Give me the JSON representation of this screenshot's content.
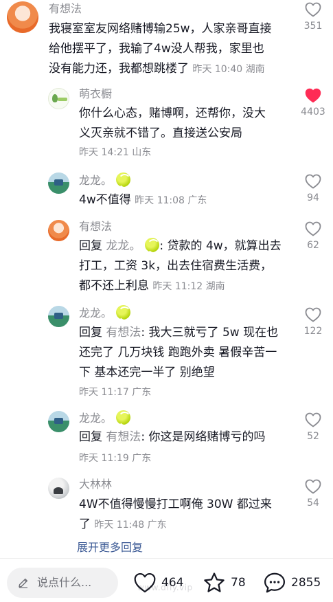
{
  "comments": [
    {
      "author": "有想法",
      "lines": [
        "我寝室室友网络赌博输25w，人家亲哥直接",
        "给他摆平了，我输了4w没人帮我，家里也",
        "没有能力还，我都想跳楼了"
      ],
      "meta": "昨天 10:40 湖南",
      "likes": "351",
      "liked": false,
      "avatar": "orange-anime-avatar"
    },
    {
      "author": "萌衣橱",
      "lines": [
        "你什么心态，赌博啊，还帮你，没大",
        "义灭亲就不错了。直接送公安局"
      ],
      "meta": "昨天 14:21 山东",
      "likes": "4403",
      "liked": true,
      "avatar": "green-logo-avatar"
    }
  ],
  "replies": [
    {
      "author": "龙龙。",
      "reply_label": "",
      "reply_to": "",
      "lines": [
        "4w不值得"
      ],
      "meta": "昨天 11:08 广东",
      "likes": "94",
      "avatar": "tennis-court-avatar",
      "badge": "tennis-ball-icon"
    },
    {
      "author": "有想法",
      "reply_label": "回复",
      "reply_to": "龙龙。",
      "lines": [
        "贷款的 4w，就算出去",
        "打工，工资 3k，出去住宿费生活费，",
        "都不还上利息"
      ],
      "meta": "昨天 11:12 湖南",
      "likes": "62",
      "avatar": "orange-anime-avatar",
      "badge": "tennis-ball-icon"
    },
    {
      "author": "龙龙。",
      "reply_label": "回复",
      "reply_to": "有想法",
      "lines": [
        "我大三就亏了 5w 现在也",
        "还完了 几万块钱 跑跑外卖 暑假辛苦一",
        "下 基本还完一半了 别绝望"
      ],
      "meta": "昨天 11:17 广东",
      "likes": "122",
      "avatar": "tennis-court-avatar",
      "badge": "tennis-ball-icon"
    },
    {
      "author": "龙龙。",
      "reply_label": "回复",
      "reply_to": "有想法",
      "lines": [
        "你这是网络赌博亏的吗"
      ],
      "meta": "昨天 11:19 广东",
      "likes": "52",
      "avatar": "tennis-court-avatar",
      "badge": "tennis-ball-icon"
    },
    {
      "author": "大林林",
      "reply_label": "",
      "reply_to": "",
      "lines": [
        "4W不值得慢慢打工啊俺 30W 都过来",
        "了"
      ],
      "meta": "昨天 11:48 广东",
      "likes": "54",
      "avatar": "gray-photo-avatar"
    }
  ],
  "expand_label": "展开更多回复",
  "bottom_bar": {
    "input_placeholder": "说点什么...",
    "likes": "464",
    "favorites": "78",
    "comments": "2855",
    "watermark": "www.dfiy.vip"
  },
  "colors": {
    "liked_heart": "#fe2c55",
    "link": "#3d5b96",
    "muted": "#8a8b91"
  }
}
